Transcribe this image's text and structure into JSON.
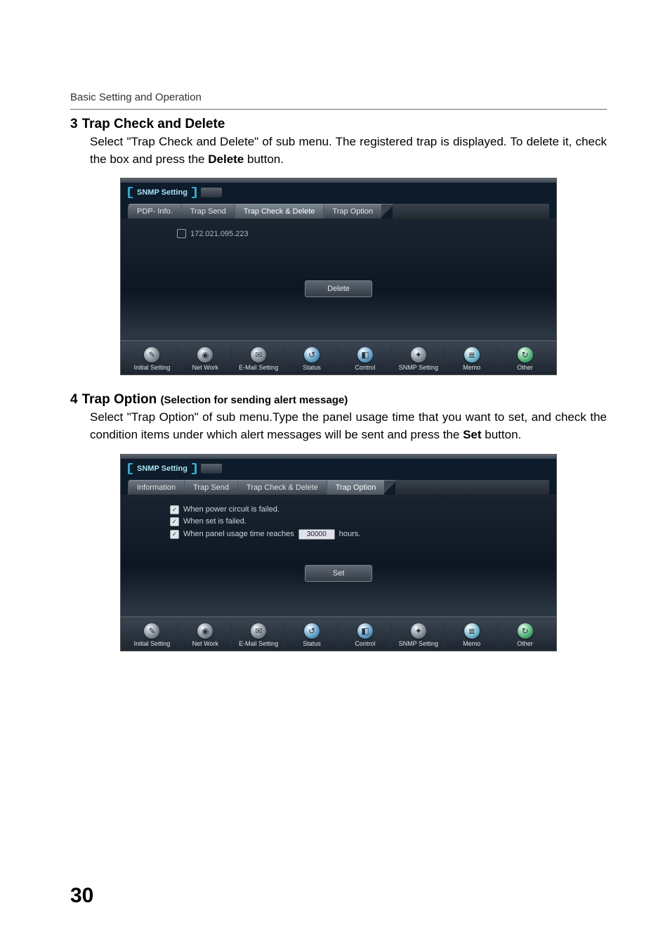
{
  "page": {
    "header": "Basic Setting and Operation",
    "number": "30"
  },
  "sections": [
    {
      "num": "3",
      "title": "Trap Check and Delete",
      "body_a": "Select \"Trap Check and Delete\" of sub menu. The registered trap is displayed. To delete it, check the box and press the ",
      "body_strong": "Delete",
      "body_b": " button."
    },
    {
      "num": "4",
      "title": "Trap Option ",
      "subtitle": "(Selection for sending alert message)",
      "body_a": "Select \"Trap Option\" of sub menu.Type the panel usage time that you want to set, and check the condition items under which alert messages will be sent and press the ",
      "body_strong": "Set",
      "body_b": " button."
    }
  ],
  "shot1": {
    "panel_label": "SNMP Setting",
    "tabs": [
      "PDP- Info.",
      "Trap Send",
      "Trap Check & Delete",
      "Trap Option"
    ],
    "active_tab": 2,
    "ip": "172.021.095.223",
    "button": "Delete"
  },
  "shot2": {
    "panel_label": "SNMP Setting",
    "tabs": [
      "Information",
      "Trap Send",
      "Trap Check & Delete",
      "Trap Option"
    ],
    "active_tab": 3,
    "conditions": [
      "When power circuit is failed.",
      "When set is failed.",
      "When panel usage time reaches"
    ],
    "hours_value": "30000",
    "hours_suffix": "hours.",
    "button": "Set"
  },
  "bottom_nav": [
    {
      "label": "Initial Setting",
      "glyph": "✎"
    },
    {
      "label": "Net Work",
      "glyph": "◉"
    },
    {
      "label": "E-Mail Setting",
      "glyph": "✉"
    },
    {
      "label": "Status",
      "glyph": "↺"
    },
    {
      "label": "Control",
      "glyph": "◧"
    },
    {
      "label": "SNMP Setting",
      "glyph": "✦"
    },
    {
      "label": "Memo",
      "glyph": "≣"
    },
    {
      "label": "Other",
      "glyph": "↻"
    }
  ]
}
